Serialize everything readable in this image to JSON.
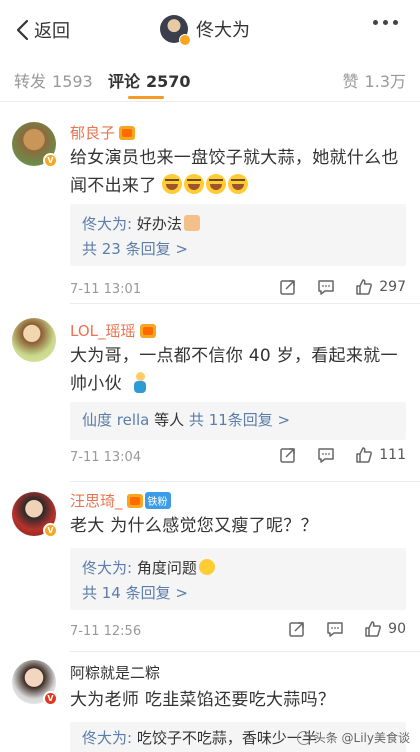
{
  "header": {
    "back_label": "返回",
    "title": "佟大为"
  },
  "tabs": [
    {
      "label": "转发",
      "count": "1593"
    },
    {
      "label": "评论",
      "count": "2570"
    },
    {
      "label": "赞",
      "count": "1.3万"
    }
  ],
  "colors": {
    "accent": "#f59a23",
    "username": "#eb7350",
    "link": "#5a7dab",
    "reply_bg": "#f5f5f5"
  },
  "comments": [
    {
      "user": "郁良子",
      "text": "给女演员也来一盘饺子就大蒜，她就什么也闻不出来了",
      "emoji": "laugh-cry x4",
      "reply": {
        "author": "佟大为:",
        "text": " 好办法"
      },
      "more": "共 23 条回复 >",
      "time": "7-11 13:01",
      "likes": "297"
    },
    {
      "user": "LOL_瑶瑶",
      "text": "大为哥，一点都不信你 40 岁，看起来就一帅小伙",
      "more_prefix": "仙度 rella",
      "more_mid": " 等人 ",
      "more": "共 11条回复 >",
      "time": "7-11 13:04",
      "likes": "111"
    },
    {
      "user": "汪思琦_",
      "badge": "铁粉",
      "text": "老大 为什么感觉您又瘦了呢？？",
      "reply": {
        "author": "佟大为:",
        "text": " 角度问题"
      },
      "more": "共 14 条回复 >",
      "time": "7-11 12:56",
      "likes": "90"
    },
    {
      "user": "阿粽就是二粽",
      "text": "大为老师 吃韭菜馅还要吃大蒜吗？",
      "reply": {
        "author": "佟大为:",
        "text": " 吃饺子不吃蒜，香味少一半"
      }
    }
  ],
  "watermark": "头条 @Lily美食谈"
}
